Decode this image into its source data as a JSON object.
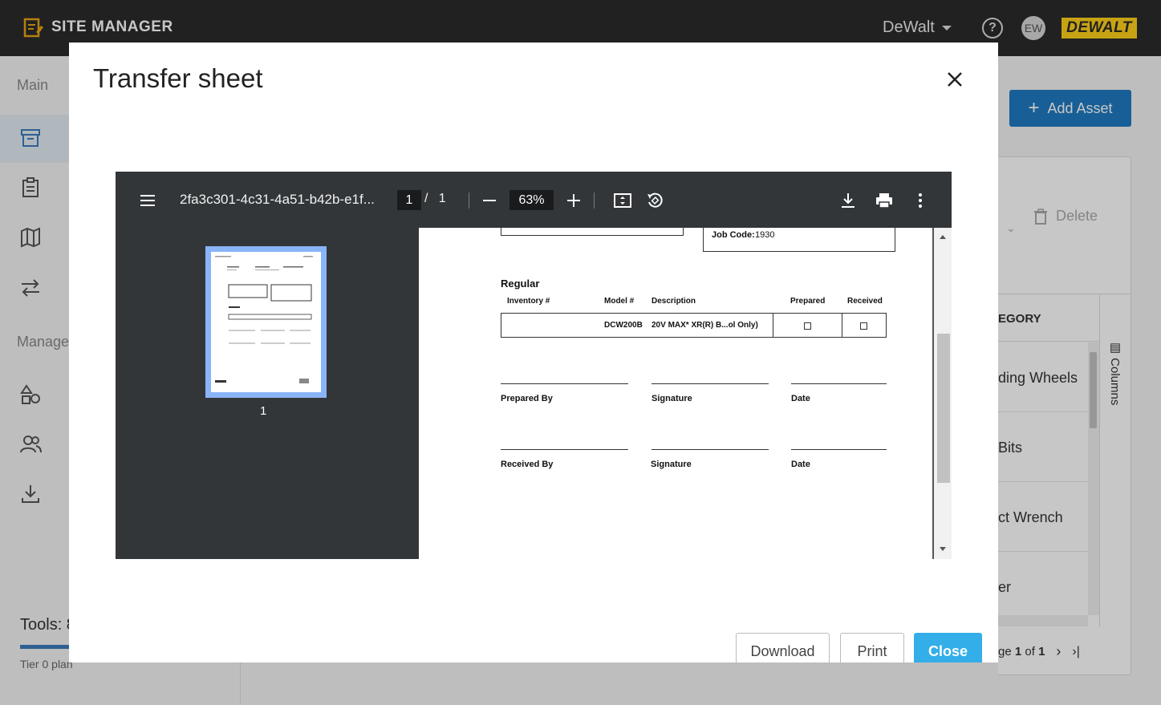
{
  "app": {
    "title": "SITE MANAGER"
  },
  "header": {
    "org_name": "DeWalt",
    "help_icon": "help-circle-icon",
    "avatar_initials": "EW",
    "logo_text": "DEWALT"
  },
  "sidebar": {
    "main_label": "Main",
    "manage_label": "Manage",
    "tools_label": "Tools: 8",
    "tools_progress_fraction": 0.26,
    "tier": "Tier 0 plan"
  },
  "background": {
    "add_asset": "Add Asset",
    "delete": "Delete",
    "category_header": "EGORY",
    "columns": "Columns",
    "rows": [
      "ding Wheels",
      "Bits",
      "ct Wrench",
      "er"
    ],
    "pager_prefix": "ge",
    "pager_page": "1",
    "pager_of": "of",
    "pager_total": "1"
  },
  "modal": {
    "title": "Transfer sheet",
    "download": "Download",
    "print": "Print",
    "close": "Close"
  },
  "pdf": {
    "filename": "2fa3c301-4c31-4a51-b42b-e1f...",
    "current_page": "1",
    "page_sep": "/",
    "total_pages": "1",
    "zoom": "63%",
    "thumb_number": "1"
  },
  "doc": {
    "job_code_label": "Job Code:",
    "job_code_value": "1930",
    "section": "Regular",
    "columns": [
      "Inventory #",
      "Model #",
      "Description",
      "Prepared",
      "Received"
    ],
    "row": {
      "inventory": "",
      "model": "DCW200B",
      "description": "20V MAX* XR(R) B...ol Only)"
    },
    "prepared_by": "Prepared By",
    "signature": "Signature",
    "date": "Date",
    "received_by": "Received By",
    "signature2": "Signature",
    "date2": "Date"
  }
}
